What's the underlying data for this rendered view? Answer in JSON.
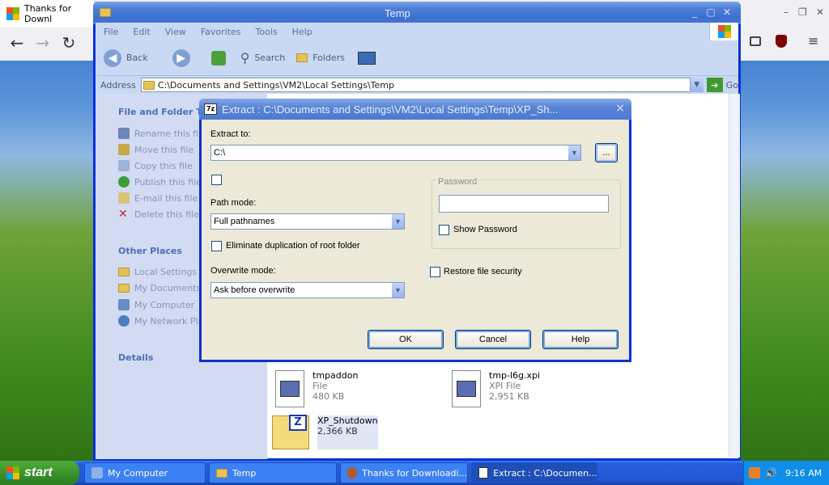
{
  "firefox": {
    "tab_title": "Thanks for Downl",
    "back": "←",
    "forward": "→",
    "reload": "↻",
    "right_icons": [
      "library-icon",
      "ublock-icon",
      "menu-icon"
    ],
    "win_min": "–",
    "win_max": "❐",
    "win_close": "✕"
  },
  "explorer": {
    "title": "Temp",
    "menu": [
      "File",
      "Edit",
      "View",
      "Favorites",
      "Tools",
      "Help"
    ],
    "toolbar": {
      "back": "Back",
      "search": "Search",
      "folders": "Folders"
    },
    "address_label": "Address",
    "address_value": "C:\\Documents and Settings\\VM2\\Local Settings\\Temp",
    "go_label": "Go",
    "file_tasks_heading": "File and Folder Tas",
    "file_tasks": [
      "Rename this file",
      "Move this file",
      "Copy this file",
      "Publish this file t",
      "E-mail this file",
      "Delete this file"
    ],
    "other_places_heading": "Other Places",
    "other_places": [
      "Local Settings",
      "My Documents",
      "My Computer",
      "My Network Plac"
    ],
    "details_heading": "Details",
    "files": [
      {
        "name": "tmpaddon",
        "type": "File",
        "size": "480 KB"
      },
      {
        "name": "tmp-l6g.xpi",
        "type": "XPI File",
        "size": "2,951 KB"
      },
      {
        "name": "XP_Shutdown",
        "type": "",
        "size": "2,366 KB"
      }
    ]
  },
  "dialog": {
    "title": "Extract : C:\\Documents and Settings\\VM2\\Local Settings\\Temp\\XP_Sh...",
    "close": "×",
    "extract_to_label": "Extract to:",
    "extract_to_value": "C:\\",
    "browse_label": "...",
    "path_mode_label": "Path mode:",
    "path_mode_value": "Full pathnames",
    "eliminate_label": "Eliminate duplication of root folder",
    "overwrite_label": "Overwrite mode:",
    "overwrite_value": "Ask before overwrite",
    "password_group": "Password",
    "show_password": "Show Password",
    "restore_security": "Restore file security",
    "ok": "OK",
    "cancel": "Cancel",
    "help": "Help"
  },
  "taskbar": {
    "start": "start",
    "items": [
      "My Computer",
      "Temp",
      "Thanks for Downloadi...",
      "Extract : C:\\Documen..."
    ],
    "clock": "9:16 AM"
  }
}
